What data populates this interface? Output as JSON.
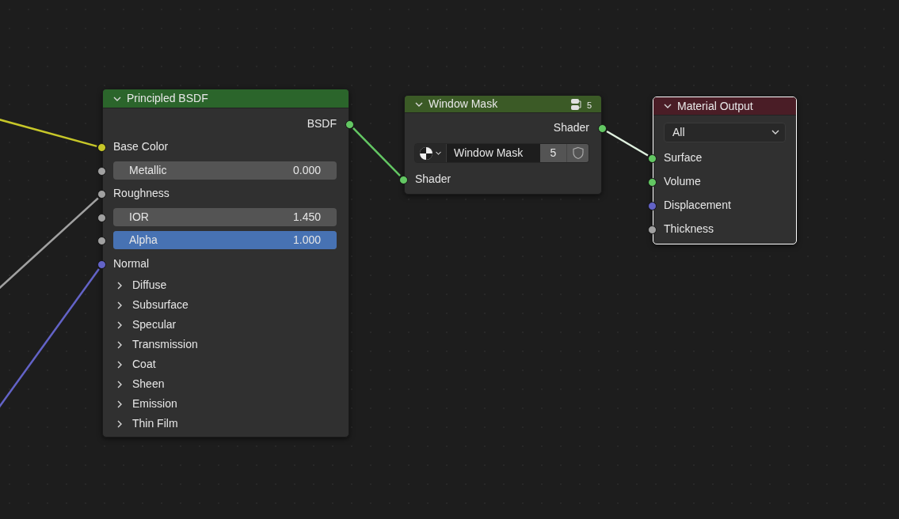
{
  "nodes": [
    {
      "title": "Principled BSDF",
      "kind": "shader",
      "selected": false,
      "expanded": true,
      "sockets": [
        {
          "kind": "output",
          "label": "BSDF",
          "color": "#63c763"
        },
        {
          "kind": "input",
          "label": "Base Color",
          "color": "#c7c729",
          "linked": true
        },
        {
          "kind": "slider",
          "label": "Metallic",
          "value": "0.000",
          "level": 0,
          "color": "#a1a1a1"
        },
        {
          "kind": "input",
          "label": "Roughness",
          "color": "#a1a1a1",
          "linked": true
        },
        {
          "kind": "number",
          "label": "IOR",
          "value": "1.450",
          "color": "#a1a1a1"
        },
        {
          "kind": "slider",
          "label": "Alpha",
          "value": "1.000",
          "level": 1,
          "color": "#a1a1a1"
        },
        {
          "kind": "input",
          "label": "Normal",
          "color": "#6363c7",
          "linked": true
        },
        {
          "kind": "panel",
          "label": "Diffuse",
          "expanded": false
        },
        {
          "kind": "panel",
          "label": "Subsurface",
          "expanded": false
        },
        {
          "kind": "panel",
          "label": "Specular",
          "expanded": false
        },
        {
          "kind": "panel",
          "label": "Transmission",
          "expanded": false
        },
        {
          "kind": "panel",
          "label": "Coat",
          "expanded": false
        },
        {
          "kind": "panel",
          "label": "Sheen",
          "expanded": false
        },
        {
          "kind": "panel",
          "label": "Emission",
          "expanded": false
        },
        {
          "kind": "panel",
          "label": "Thin Film",
          "expanded": false
        }
      ]
    },
    {
      "title": "Window Mask",
      "kind": "group",
      "selected": false,
      "expanded": true,
      "users": "5",
      "sockets": [
        {
          "kind": "output",
          "label": "Shader",
          "color": "#63c763"
        },
        {
          "kind": "datablock",
          "name": "Window Mask",
          "users": "5"
        },
        {
          "kind": "input",
          "label": "Shader",
          "color": "#63c763",
          "linked": true
        }
      ]
    },
    {
      "title": "Material Output",
      "kind": "output",
      "selected": true,
      "expanded": true,
      "sockets": [
        {
          "kind": "dropdown",
          "value": "All"
        },
        {
          "kind": "input",
          "label": "Surface",
          "color": "#63c763",
          "linked": true
        },
        {
          "kind": "input",
          "label": "Volume",
          "color": "#63c763",
          "linked": false
        },
        {
          "kind": "input",
          "label": "Displacement",
          "color": "#6363c7",
          "linked": false
        },
        {
          "kind": "input",
          "label": "Thickness",
          "color": "#a1a1a1",
          "linked": false
        }
      ]
    }
  ]
}
